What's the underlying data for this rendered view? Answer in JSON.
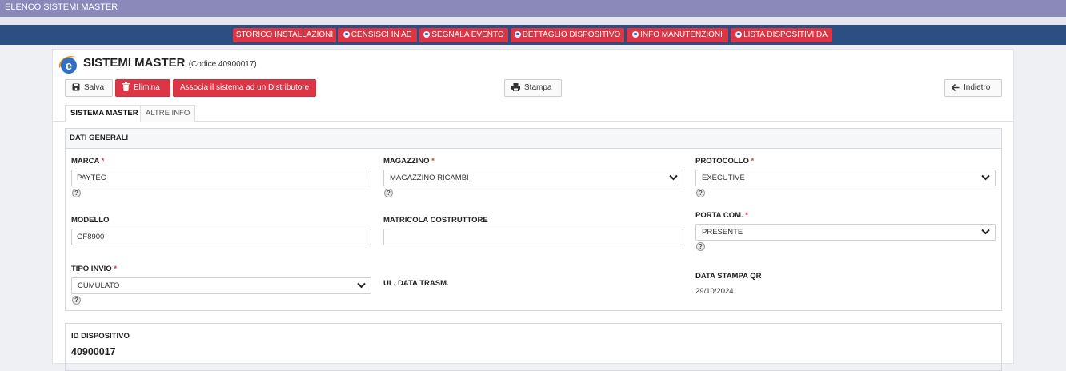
{
  "topbar": {
    "title": "ELENCO SISTEMI MASTER"
  },
  "nav": {
    "items": [
      {
        "label": "STORICO INSTALLAZIONI",
        "has_icon": false
      },
      {
        "label": "CENSISCI IN AE",
        "has_icon": true
      },
      {
        "label": "SEGNALA EVENTO",
        "has_icon": true
      },
      {
        "label": "DETTAGLIO DISPOSITIVO",
        "has_icon": true
      },
      {
        "label": "INFO MANUTENZIONI",
        "has_icon": true
      },
      {
        "label": "LISTA DISPOSITIVI DA",
        "has_icon": true
      }
    ],
    "button_color": "#dc3545",
    "bar_color": "#2b4f83"
  },
  "header": {
    "title": "SISTEMI MASTER",
    "code": "(Codice 40900017)"
  },
  "toolbar": {
    "save_label": "Salva",
    "delete_label": "Elimina",
    "assign_label": "Associa il sistema ad un Distributore",
    "print_label": "Stampa",
    "back_label": "Indietro"
  },
  "tabs": [
    {
      "label": "SISTEMA MASTER",
      "active": true
    },
    {
      "label": "ALTRE INFO",
      "active": false
    }
  ],
  "general": {
    "heading": "DATI GENERALI",
    "marca": {
      "label": "MARCA",
      "value": "PAYTEC",
      "required": true
    },
    "magazzino": {
      "label": "MAGAZZINO",
      "value": "MAGAZZINO RICAMBI",
      "required": true
    },
    "protocollo": {
      "label": "PROTOCOLLO",
      "value": "EXECUTIVE",
      "required": true
    },
    "modello": {
      "label": "MODELLO",
      "value": "GF8900"
    },
    "matricola": {
      "label": "MATRICOLA COSTRUTTORE",
      "value": ""
    },
    "porta": {
      "label": "PORTA COM.",
      "value": "PRESENTE",
      "required": true
    },
    "tipo_invio": {
      "label": "TIPO INVIO",
      "value": "CUMULATO",
      "required": true
    },
    "ul_data": {
      "label": "UL. DATA TRASM."
    },
    "data_stampa": {
      "label": "DATA STAMPA QR",
      "value": "29/10/2024"
    },
    "required_mark": "*",
    "help_glyph": "?"
  },
  "device": {
    "label": "ID DISPOSITIVO",
    "value": "40900017"
  }
}
